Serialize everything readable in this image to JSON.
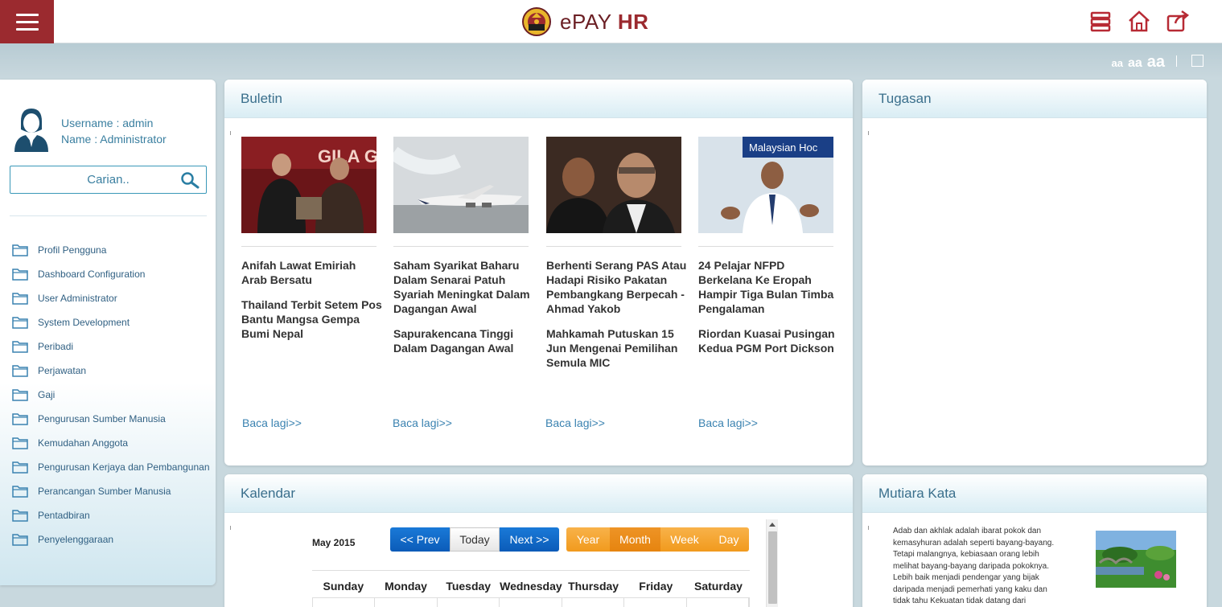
{
  "app": {
    "brand_prefix": "ePAY ",
    "brand_suffix": "HR"
  },
  "fontsizes": {
    "small": "aa",
    "medium": "aa",
    "large": "aa"
  },
  "user": {
    "username": "Username : admin",
    "name": "Name : Administrator"
  },
  "search": {
    "placeholder": "Carian.."
  },
  "nav": [
    "Profil Pengguna",
    "Dashboard Configuration",
    "User Administrator",
    "System Development",
    "Peribadi",
    "Perjawatan",
    "Gaji",
    "Pengurusan Sumber Manusia",
    "Kemudahan Anggota",
    "Pengurusan Kerjaya dan Pembangunan",
    "Perancangan Sumber Manusia",
    "Pentadbiran",
    "Penyelenggaraan"
  ],
  "buletin": {
    "title": "Buletin",
    "read_more": "Baca lagi>>",
    "columns": [
      {
        "titles": [
          "Anifah Lawat Emiriah Arab Bersatu",
          "Thailand Terbit Setem Pos Bantu Mangsa Gempa Bumi Nepal"
        ],
        "image_label": "GILA GIL"
      },
      {
        "titles": [
          "Saham Syarikat Baharu Dalam Senarai Patuh Syariah Meningkat Dalam Dagangan Awal",
          "Sapurakencana Tinggi Dalam Dagangan Awal"
        ],
        "image_label": ""
      },
      {
        "titles": [
          "Berhenti Serang PAS Atau Hadapi Risiko Pakatan Pembangkang Berpecah - Ahmad Yakob",
          "Mahkamah Putuskan 15 Jun Mengenai Pemilihan Semula MIC"
        ],
        "image_label": ""
      },
      {
        "titles": [
          "24 Pelajar NFPD Berkelana Ke Eropah Hampir Tiga Bulan Timba Pengalaman",
          "Riordan Kuasai Pusingan Kedua PGM Port Dickson"
        ],
        "image_label": "Malaysian Hoc"
      }
    ]
  },
  "tugasan": {
    "title": "Tugasan"
  },
  "kalendar": {
    "title": "Kalendar",
    "month": "May 2015",
    "prev": "<< Prev",
    "today": "Today",
    "next": "Next >>",
    "views": [
      "Year",
      "Month",
      "Week",
      "Day"
    ],
    "days": [
      "Sunday",
      "Monday",
      "Tuesday",
      "Wednesday",
      "Thursday",
      "Friday",
      "Saturday"
    ]
  },
  "mutiara": {
    "title": "Mutiara Kata",
    "lines": [
      "Adab dan akhlak adalah ibarat pokok dan",
      "kemasyhuran adalah seperti bayang-bayang.",
      "Tetapi malangnya, kebiasaan orang lebih",
      "melihat bayang-bayang daripada pokoknya.",
      "Lebih baik menjadi pendengar yang bijak",
      "daripada menjadi pemerhati yang kaku dan",
      "tidak tahu Kekuatan tidak datang dari"
    ]
  },
  "colors": {
    "brand": "#9b2a2f",
    "accent": "#3a82b0",
    "orange": "#f19a1d",
    "blue": "#0b5bb8"
  }
}
